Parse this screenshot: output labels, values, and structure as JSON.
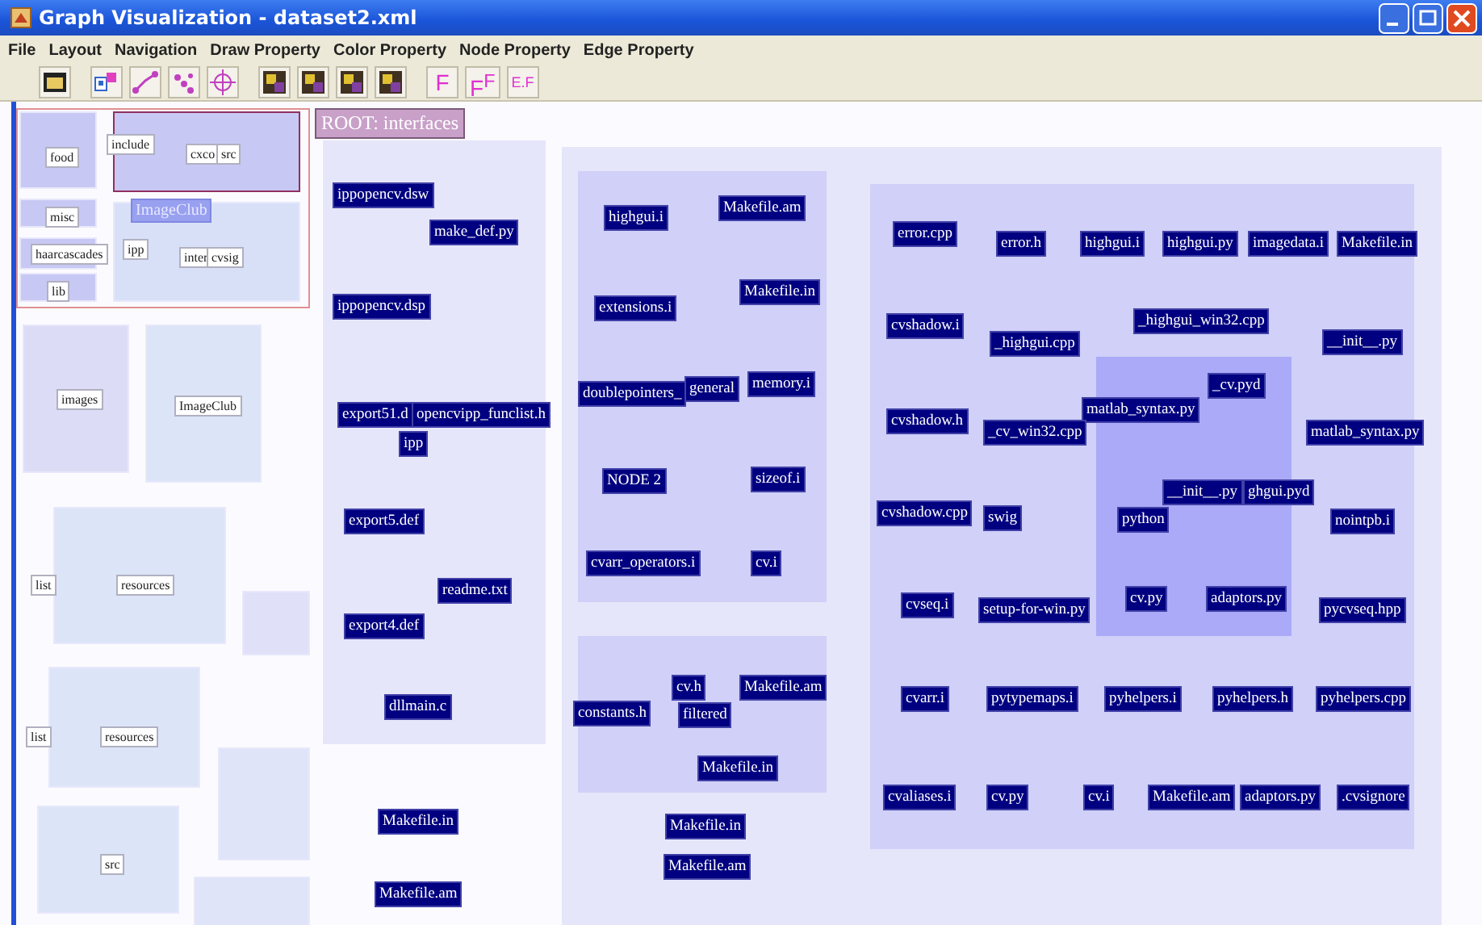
{
  "window": {
    "title": "Graph Visualization - dataset2.xml"
  },
  "menu": [
    "File",
    "Layout",
    "Navigation",
    "Draw Property",
    "Color Property",
    "Node Property",
    "Edge Property"
  ],
  "toolbar_text_buttons": [
    "F",
    "F$^{F}$",
    "E.F"
  ],
  "overview_labels": [
    {
      "label": "food",
      "selected": false
    },
    {
      "label": "include",
      "selected": false
    },
    {
      "label": "cxco",
      "selected": false
    },
    {
      "label": "src",
      "selected": false
    },
    {
      "label": "misc",
      "selected": false
    },
    {
      "label": "ImageClub",
      "selected": true
    },
    {
      "label": "haarcascades",
      "selected": false
    },
    {
      "label": "ipp",
      "selected": false
    },
    {
      "label": "inter",
      "selected": false
    },
    {
      "label": "cvsig",
      "selected": false
    },
    {
      "label": "lib",
      "selected": false
    },
    {
      "label": "images",
      "selected": false
    },
    {
      "label": "ImageClub",
      "selected": false
    },
    {
      "label": "list",
      "selected": false
    },
    {
      "label": "resources",
      "selected": false
    },
    {
      "label": "list",
      "selected": false
    },
    {
      "label": "resources",
      "selected": false
    },
    {
      "label": "src",
      "selected": false
    }
  ],
  "root_label": "ROOT: interfaces",
  "nodes": [
    "ippopencv.dsw",
    "make_def.py",
    "ippopencv.dsp",
    "export51.d",
    "opencvipp_funclist.h",
    "ipp",
    "export5.def",
    "readme.txt",
    "export4.def",
    "dllmain.c",
    "Makefile.in",
    "Makefile.am",
    "highgui.i",
    "Makefile.am",
    "Makefile.in",
    "extensions.i",
    "doublepointers_",
    "general",
    "memory.i",
    "NODE 2",
    "sizeof.i",
    "cvarr_operators.i",
    "cv.i",
    "cv.h",
    "Makefile.am",
    "constants.h",
    "filtered",
    "Makefile.in",
    "Makefile.in",
    "Makefile.am",
    "error.cpp",
    "error.h",
    "highgui.i",
    "highgui.py",
    "imagedata.i",
    "Makefile.in",
    "cvshadow.i",
    "_highgui_win32.cpp",
    "_highgui.cpp",
    "__init__.py",
    "_cv.pyd",
    "matlab_syntax.py",
    "cvshadow.h",
    "_cv_win32.cpp",
    "matlab_syntax.py",
    "__init__.py",
    "ghgui.pyd",
    "python",
    "cvshadow.cpp",
    "swig",
    "nointpb.i",
    "cvseq.i",
    "setup-for-win.py",
    "cv.py",
    "adaptors.py",
    "pycvseq.hpp",
    "cvarr.i",
    "pytypemaps.i",
    "pyhelpers.i",
    "pyhelpers.h",
    "pyhelpers.cpp",
    "cvaliases.i",
    "cv.py",
    "cv.i",
    "Makefile.am",
    "adaptors.py",
    ".cvsignore"
  ]
}
